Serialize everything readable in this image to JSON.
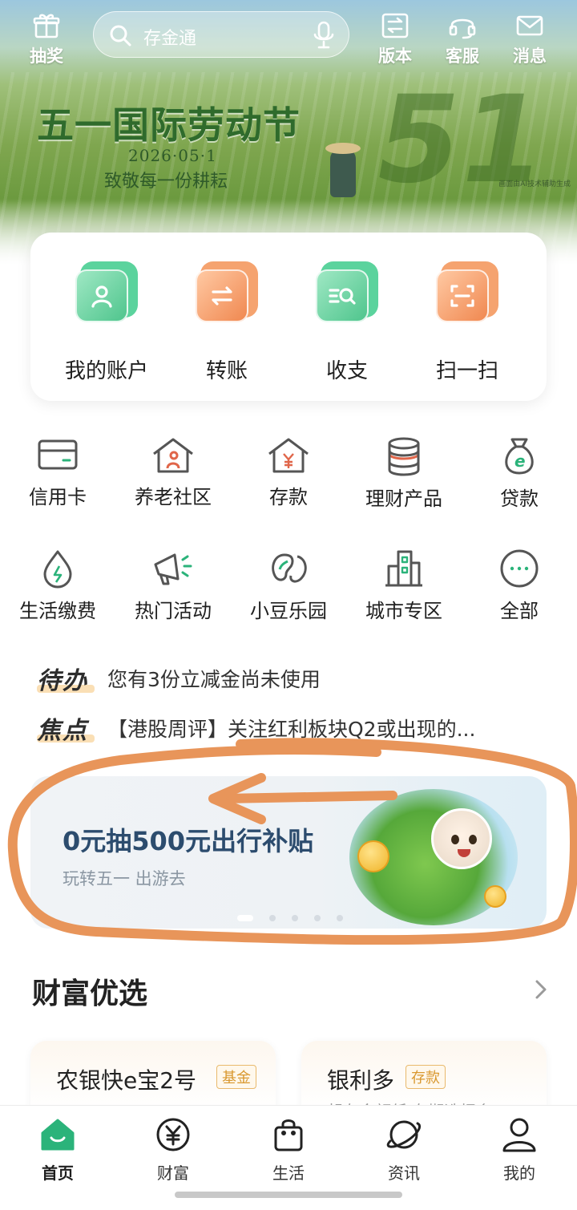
{
  "topbar": {
    "lottery_label": "抽奖",
    "search_placeholder": "存金通",
    "version_label": "版本",
    "service_label": "客服",
    "message_label": "消息"
  },
  "banner": {
    "title": "五一国际劳动节",
    "date": "2026·05·1",
    "subtitle": "致敬每一份耕耘",
    "big_number": "51",
    "ai_note": "画面由AI技术辅助生成"
  },
  "quick_actions": [
    {
      "label": "我的账户",
      "icon": "user-card-icon"
    },
    {
      "label": "转账",
      "icon": "transfer-icon"
    },
    {
      "label": "收支",
      "icon": "income-expense-icon"
    },
    {
      "label": "扫一扫",
      "icon": "scan-icon"
    }
  ],
  "grid_row1": [
    {
      "label": "信用卡",
      "icon": "credit-card-icon"
    },
    {
      "label": "养老社区",
      "icon": "elderly-home-icon"
    },
    {
      "label": "存款",
      "icon": "deposit-house-icon"
    },
    {
      "label": "理财产品",
      "icon": "coin-stack-icon"
    },
    {
      "label": "贷款",
      "icon": "money-bag-icon"
    }
  ],
  "grid_row2": [
    {
      "label": "生活缴费",
      "icon": "water-drop-icon"
    },
    {
      "label": "热门活动",
      "icon": "megaphone-icon"
    },
    {
      "label": "小豆乐园",
      "icon": "bean-icon"
    },
    {
      "label": "城市专区",
      "icon": "buildings-icon"
    },
    {
      "label": "全部",
      "icon": "more-dots-icon"
    }
  ],
  "todo": {
    "tag": "待办",
    "text": "您有3份立减金尚未使用"
  },
  "focus": {
    "tag": "焦点",
    "text": "【港股周评】关注红利板块Q2或出现的..."
  },
  "promo": {
    "title": "0元抽500元出行补贴",
    "subtitle": "玩转五一 出游去",
    "slide_count": 5,
    "active_slide": 1
  },
  "wealth": {
    "title": "财富优选",
    "cards": [
      {
        "name": "农银快e宝2号",
        "badge": "基金",
        "sub": ""
      },
      {
        "name": "银利多",
        "badge": "存款",
        "sub": "起存金额低 存期选择多"
      }
    ]
  },
  "bottom_nav": [
    {
      "label": "首页",
      "icon": "home-icon",
      "active": true
    },
    {
      "label": "财富",
      "icon": "yen-circle-icon",
      "active": false
    },
    {
      "label": "生活",
      "icon": "shopping-bag-icon",
      "active": false
    },
    {
      "label": "资讯",
      "icon": "planet-icon",
      "active": false
    },
    {
      "label": "我的",
      "icon": "person-icon",
      "active": false
    }
  ],
  "colors": {
    "brand_green": "#2bb37a",
    "accent_orange": "#f08850",
    "annotation": "#e8955a",
    "promo_title": "#2c4c6e"
  }
}
